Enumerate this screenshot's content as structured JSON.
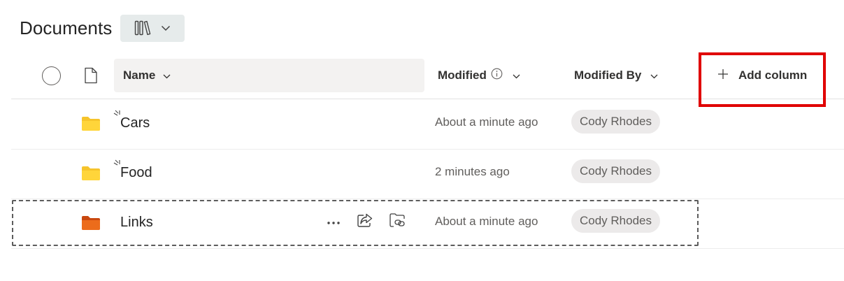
{
  "page": {
    "title": "Documents",
    "view_switch_icon": "library-icon"
  },
  "header": {
    "name_label": "Name",
    "modified_label": "Modified",
    "modified_by_label": "Modified By",
    "add_column_label": "Add column"
  },
  "rows": [
    {
      "name": "Cars",
      "modified": "About a minute ago",
      "modified_by": "Cody Rhodes",
      "folder_color": "#f4c430",
      "is_new": true
    },
    {
      "name": "Food",
      "modified": "2 minutes ago",
      "modified_by": "Cody Rhodes",
      "folder_color": "#f4c430",
      "is_new": true
    },
    {
      "name": "Links",
      "modified": "About a minute ago",
      "modified_by": "Cody Rhodes",
      "folder_color": "#e8681a",
      "is_new": false
    }
  ],
  "colors": {
    "highlight": "#e00000",
    "header_bg": "#f3f2f1",
    "persona_bg": "#eceaea"
  }
}
